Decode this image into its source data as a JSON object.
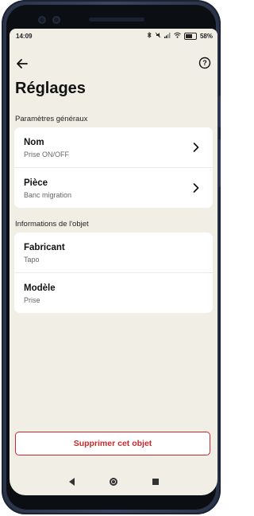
{
  "status": {
    "time": "14:09",
    "battery": "58"
  },
  "header": {
    "title": "Réglages",
    "back_icon": "back-arrow-icon",
    "help_icon": "help-icon"
  },
  "sections": [
    {
      "label": "Paramètres généraux",
      "items": [
        {
          "title": "Nom",
          "subtitle": "Prise ON/OFF",
          "chevron": true
        },
        {
          "title": "Pièce",
          "subtitle": "Banc migration",
          "chevron": true
        }
      ]
    },
    {
      "label": "Informations de l'objet",
      "items": [
        {
          "title": "Fabricant",
          "subtitle": "Tapo",
          "chevron": false
        },
        {
          "title": "Modèle",
          "subtitle": "Prise",
          "chevron": false
        }
      ]
    }
  ],
  "actions": {
    "delete_label": "Supprimer cet objet"
  },
  "colors": {
    "background": "#f1eee6",
    "card": "#ffffff",
    "danger": "#c8282d"
  }
}
